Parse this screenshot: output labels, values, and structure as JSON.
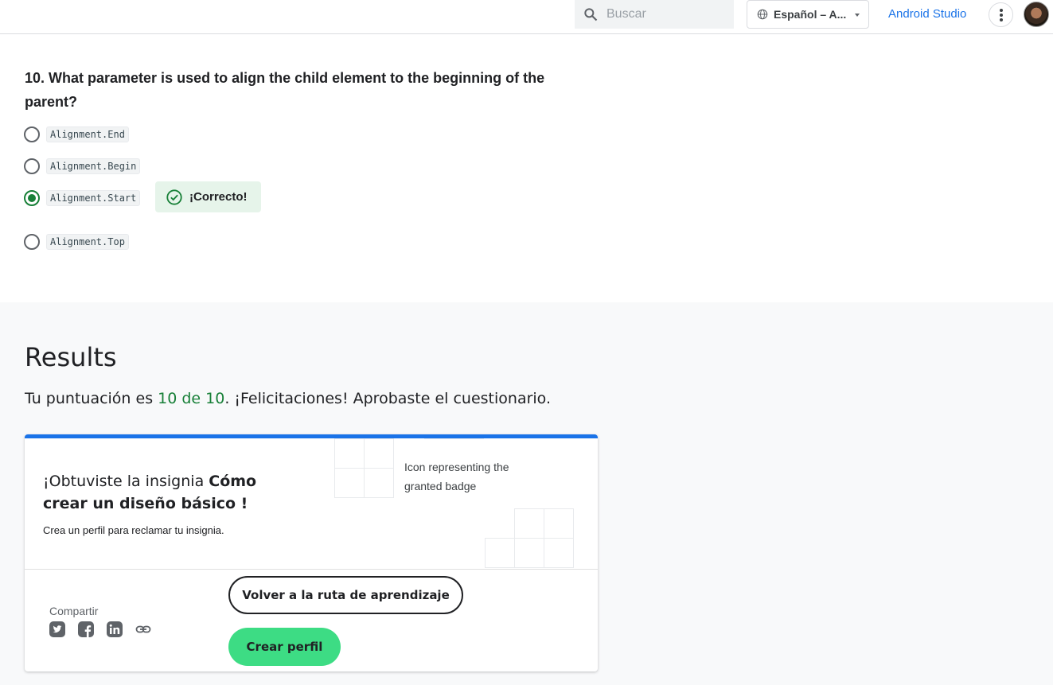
{
  "header": {
    "search_placeholder": "Buscar",
    "language_label": "Español – A...",
    "studio_link": "Android Studio"
  },
  "quiz": {
    "question": "10.  What parameter is used to align the child element to the beginning of the parent?",
    "options": [
      {
        "label": "Alignment.End",
        "selected": false
      },
      {
        "label": "Alignment.Begin",
        "selected": false
      },
      {
        "label": "Alignment.Start",
        "selected": true
      },
      {
        "label": "Alignment.Top",
        "selected": false
      }
    ],
    "feedback": "¡Correcto!"
  },
  "results": {
    "title": "Results",
    "score_prefix": "Tu puntuación es ",
    "score": "10 de 10",
    "score_suffix": ". ¡Felicitaciones! Aprobaste el cuestionario.",
    "badge": {
      "title_prefix": "¡Obtuviste la insignia ",
      "title_name": "Cómo crear un diseño básico",
      "title_suffix": " !",
      "subtitle": "Crea un perfil para reclamar tu insignia.",
      "icon_alt": "Icon representing the granted badge"
    },
    "share_label": "Compartir",
    "share_icons": [
      "twitter-icon",
      "facebook-icon",
      "linkedin-icon",
      "link-icon"
    ],
    "back_button": "Volver a la ruta de aprendizaje",
    "create_profile_button": "Crear perfil"
  },
  "colors": {
    "accent_blue": "#1a73e8",
    "correct_green": "#188038",
    "android_green": "#3ddc84",
    "correct_bg": "#e6f4ea"
  }
}
